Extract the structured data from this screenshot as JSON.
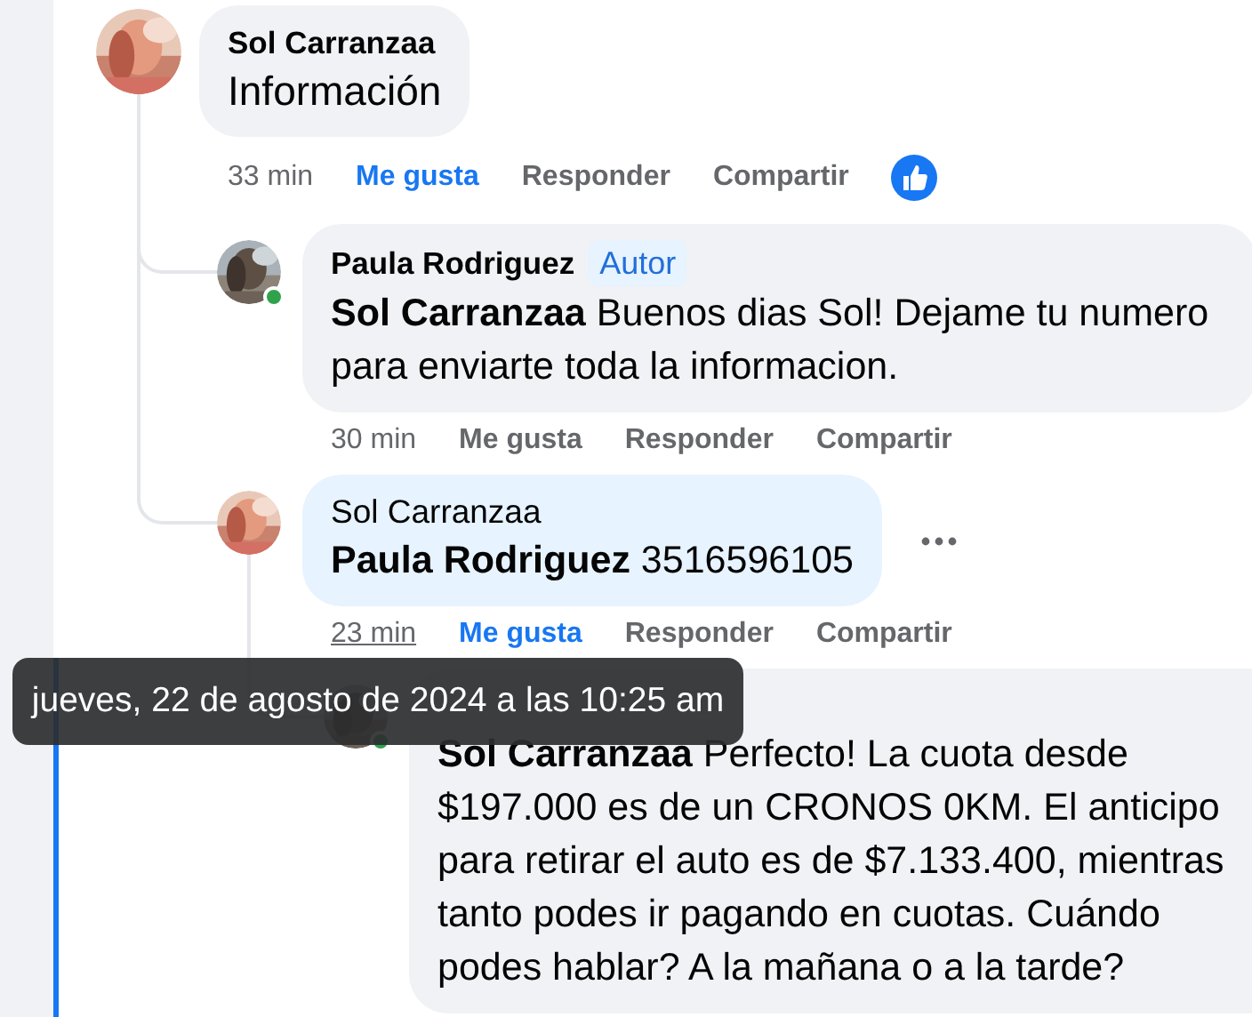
{
  "comments": [
    {
      "author": "Sol Carranzaa",
      "text": "Información",
      "highlighted": false,
      "time": "33 min",
      "time_hovered": false,
      "like_label": "Me gusta",
      "liked": true,
      "reply_label": "Responder",
      "share_label": "Compartir",
      "like_reaction": true,
      "children": [
        {
          "author": "Paula Rodriguez",
          "badge": "Autor",
          "text": "**Sol Carranzaa** Buenos dias Sol! Dejame tu numero para enviarte toda la informacion.",
          "online": true,
          "highlighted": false,
          "time": "30 min",
          "time_hovered": false,
          "like_label": "Me gusta",
          "liked": false,
          "reply_label": "Responder",
          "share_label": "Compartir"
        },
        {
          "author": "Sol Carranzaa",
          "text": "**Paula Rodriguez** 3516596105",
          "highlighted": true,
          "time": "23 min",
          "time_hovered": true,
          "like_label": "Me gusta",
          "liked": true,
          "reply_label": "Responder",
          "share_label": "Compartir",
          "more_shown": true,
          "children": [
            {
              "text": "**Sol Carranzaa** Perfecto! La cuota desde $197.000 es de un CRONOS 0KM. El anticipo para retirar el auto es de $7.133.400, mientras tanto podes ir pagando en cuotas. Cuándo podes hablar? A la mañana o a la tarde?",
              "online": true
            }
          ]
        }
      ]
    }
  ],
  "tooltip": {
    "text": "jueves, 22 de agosto de 2024 a las 10:25 am"
  }
}
